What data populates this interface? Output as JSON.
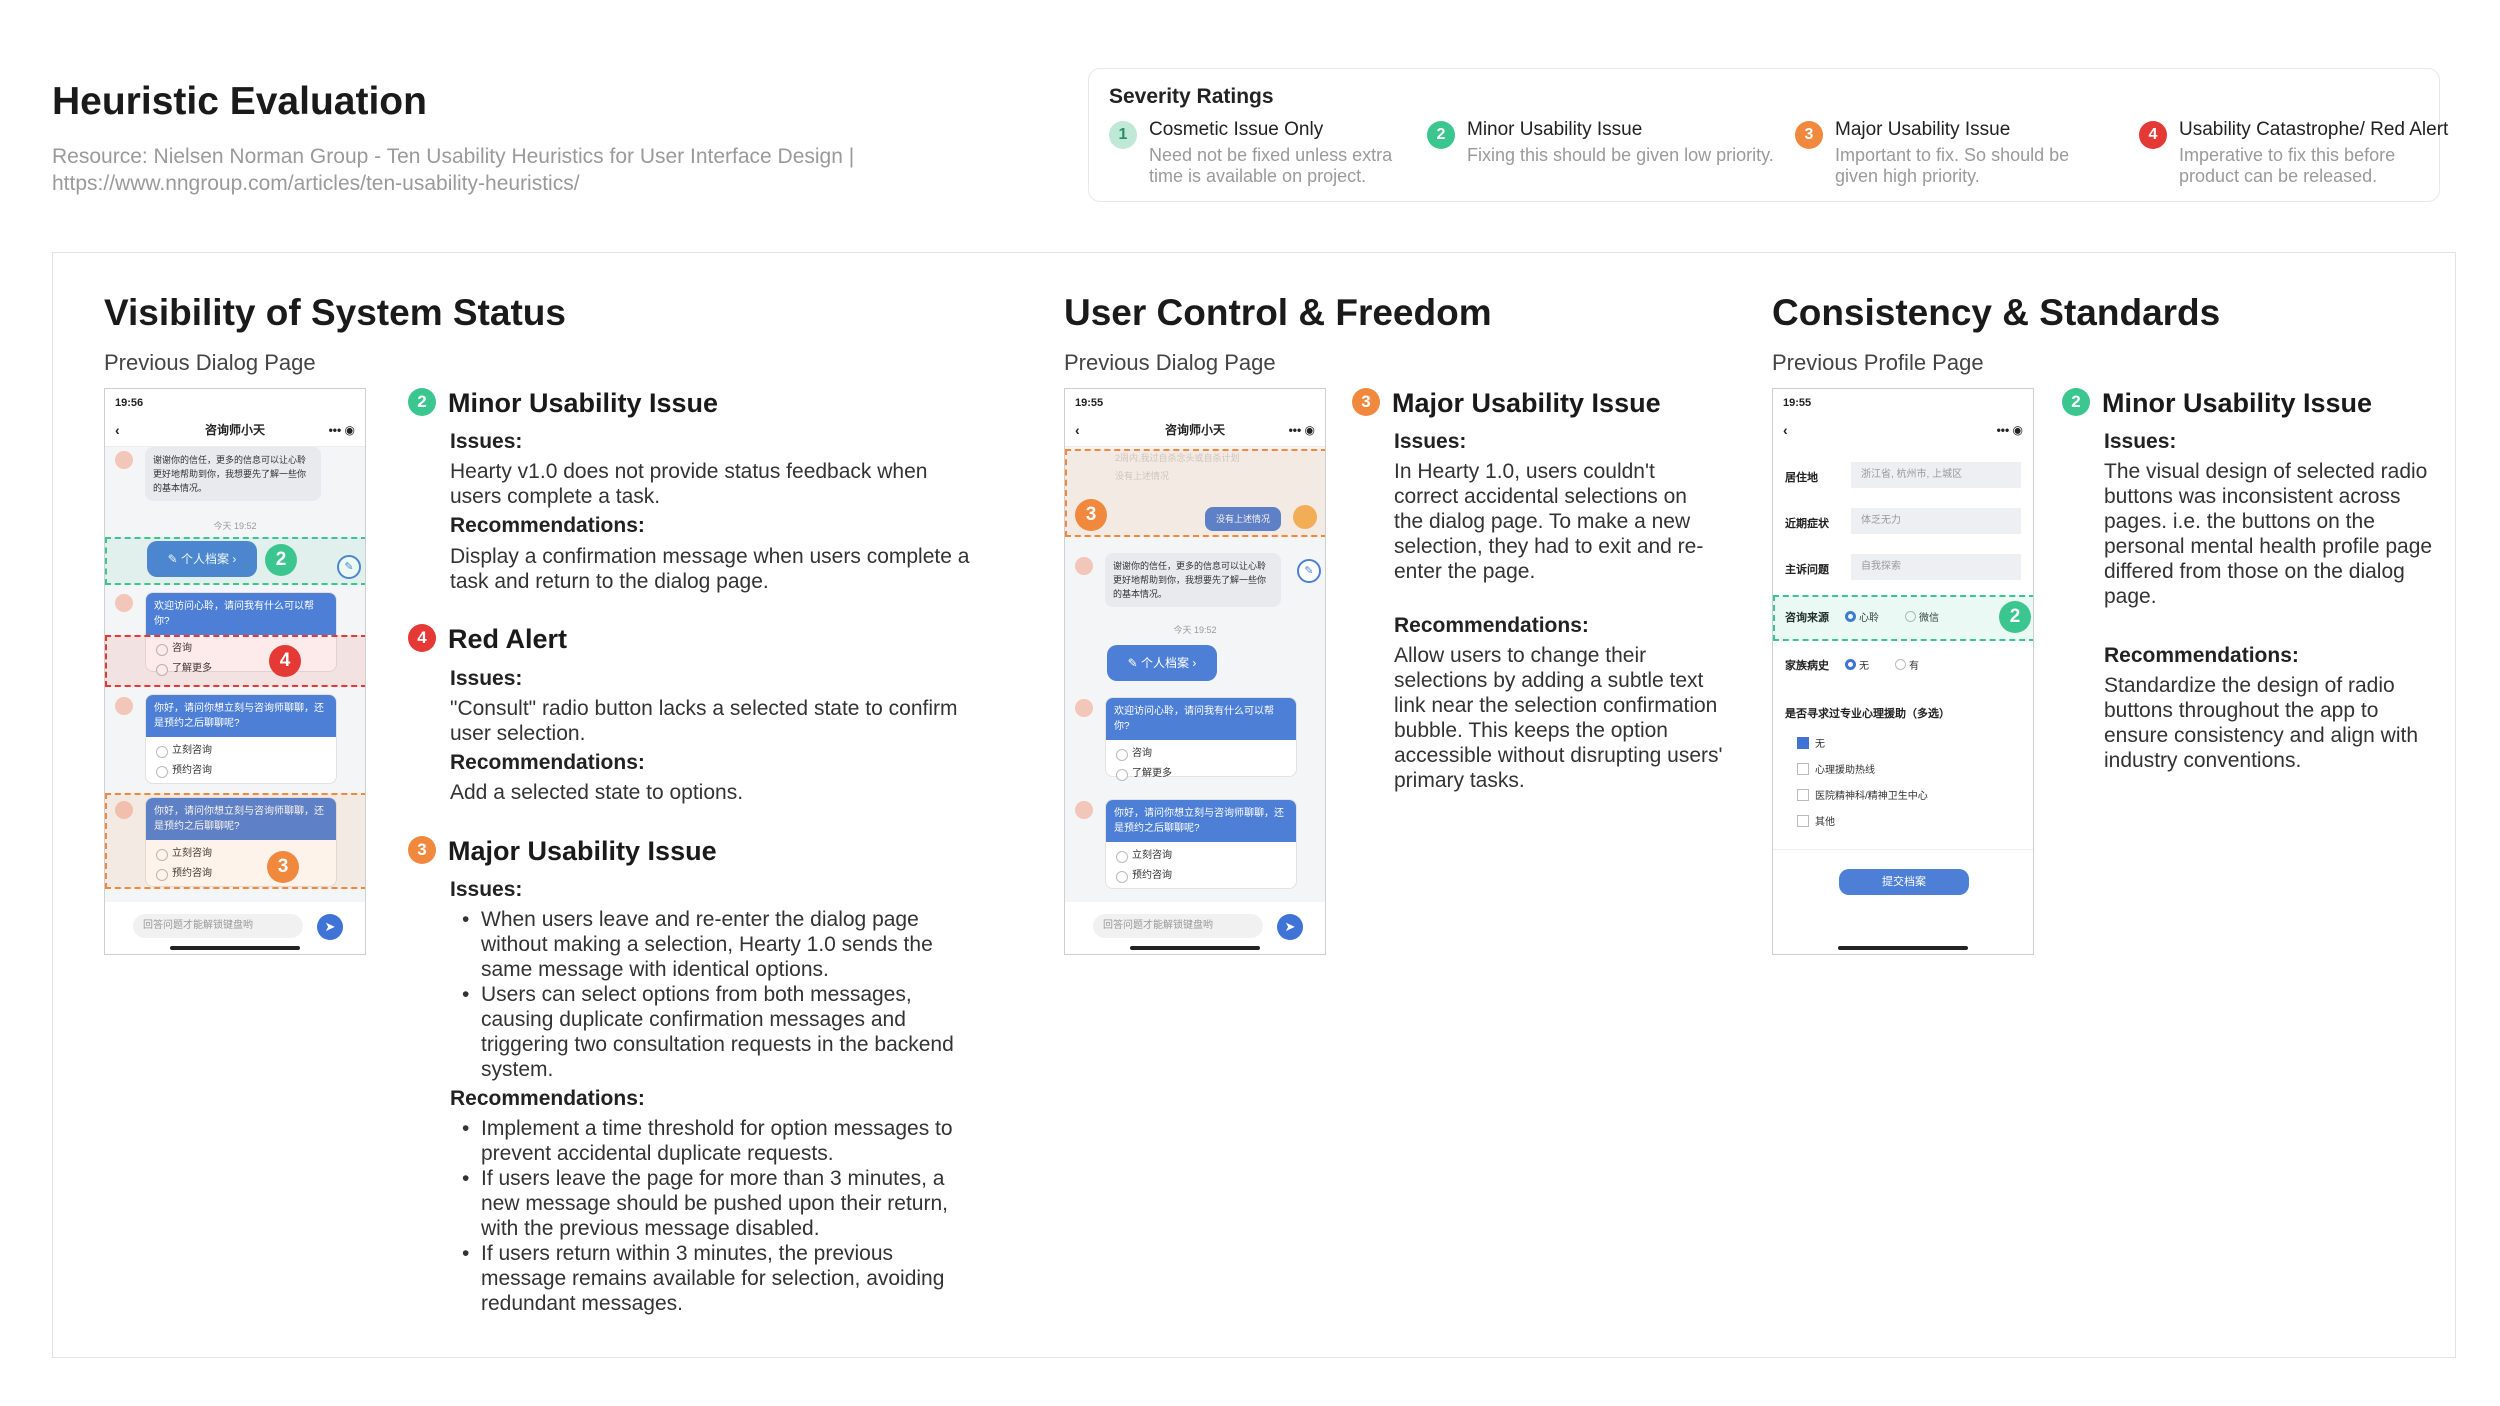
{
  "header": {
    "title": "Heuristic Evaluation",
    "resource": "Resource: Nielsen Norman Group - Ten Usability Heuristics for User Interface Design | https://www.nngroup.com/articles/ten-usability-heuristics/"
  },
  "severity": {
    "title": "Severity Ratings",
    "items": [
      {
        "num": "1",
        "name": "Cosmetic Issue Only",
        "desc": "Need not be fixed unless extra time is available on project.",
        "color": "#bfe8d6"
      },
      {
        "num": "2",
        "name": "Minor Usability Issue",
        "desc": "Fixing this should be given low priority.",
        "color": "#3cc68f"
      },
      {
        "num": "3",
        "name": "Major Usability Issue",
        "desc": "Important to fix. So should be given high priority.",
        "color": "#f0883e"
      },
      {
        "num": "4",
        "name": "Usability Catastrophe/ Red Alert",
        "desc": "Imperative to fix this before product can be released.",
        "color": "#e53935"
      }
    ]
  },
  "sections": [
    {
      "title": "Visibility of System Status",
      "subtitle": "Previous Dialog Page",
      "phone": {
        "time": "19:56",
        "nav_title": "咨询师小天",
        "msg1": "谢谢你的信任，更多的信息可以让心聆更好地帮助到你，我想要先了解一些你的基本情况。",
        "timestamp": "今天 19:52",
        "profile_pill": "个人档案",
        "msg2": "欢迎访问心聆，请问我有什么可以帮你?",
        "opt_consult": "咨询",
        "opt_learn": "了解更多",
        "msg3": "你好，请问你想立刻与咨询师聊聊，还是预约之后聊聊呢?",
        "opt_now": "立刻咨询",
        "opt_book": "预约咨询",
        "input_placeholder": "回答问题才能解锁键盘哟",
        "badge_green": "2",
        "badge_red": "4",
        "badge_orange": "3"
      },
      "issues": [
        {
          "num": "2",
          "heading": "Minor Usability Issue",
          "issues_label": "Issues:",
          "issue_text": "Hearty v1.0 does not provide status feedback when users complete a task.",
          "rec_label": "Recommendations:",
          "rec_text": "Display a confirmation message when users complete a task and return to the dialog page."
        },
        {
          "num": "4",
          "heading": "Red Alert",
          "issues_label": "Issues:",
          "issue_text": "\"Consult\" radio button lacks a selected state to confirm user selection.",
          "rec_label": "Recommendations:",
          "rec_text": "Add a selected state to options."
        },
        {
          "num": "3",
          "heading": "Major Usability Issue",
          "issues_label": "Issues:",
          "issue_bullets": [
            "When users leave and re-enter the dialog page without making a selection, Hearty 1.0 sends the same message with identical options.",
            "Users can select options from both messages, causing duplicate confirmation messages and triggering two consultation requests in the backend system."
          ],
          "rec_label": "Recommendations:",
          "rec_bullets": [
            "Implement a time threshold for option messages to prevent accidental duplicate requests.",
            "If users leave the page for more than 3 minutes, a new message should be pushed upon their return, with the previous message disabled.",
            "If users return within 3 minutes, the previous message remains available for selection, avoiding redundant messages."
          ]
        }
      ]
    },
    {
      "title": "User Control & Freedom",
      "subtitle": "Previous Dialog Page",
      "phone": {
        "time": "19:55",
        "nav_title": "咨询师小天",
        "faded1": "2周内,我过自杀念头或自杀计划",
        "faded2": "没有上述情况",
        "user_reply": "没有上述情况",
        "msg1": "谢谢你的信任，更多的信息可以让心聆更好地帮助到你，我想要先了解一些你的基本情况。",
        "timestamp": "今天 19:52",
        "profile_pill": "个人档案",
        "msg2": "欢迎访问心聆，请问我有什么可以帮你?",
        "opt_consult": "咨询",
        "opt_learn": "了解更多",
        "msg3": "你好，请问你想立刻与咨询师聊聊，还是预约之后聊聊呢?",
        "opt_now": "立刻咨询",
        "opt_book": "预约咨询",
        "input_placeholder": "回答问题才能解锁键盘哟",
        "badge_orange": "3"
      },
      "issues": [
        {
          "num": "3",
          "heading": "Major Usability Issue",
          "issues_label": "Issues:",
          "issue_text": "In Hearty 1.0, users couldn't correct accidental selections on the dialog page. To make a new selection, they had to exit and re-enter the page.",
          "rec_label": "Recommendations:",
          "rec_text": "Allow users to change their selections by adding a subtle text link near the selection confirmation bubble. This keeps the option accessible without disrupting users' primary tasks."
        }
      ]
    },
    {
      "title": "Consistency & Standards",
      "subtitle": "Previous Profile Page",
      "phone": {
        "time": "19:55",
        "rows": [
          {
            "label": "居住地",
            "value": "浙江省, 杭州市, 上城区"
          },
          {
            "label": "近期症状",
            "value": "体乏无力"
          },
          {
            "label": "主诉问题",
            "value": "自我探索"
          }
        ],
        "source_label": "咨询来源",
        "source_opt1": "心聆",
        "source_opt2": "微信",
        "family_label": "家族病史",
        "family_opt1": "无",
        "family_opt2": "有",
        "help_question": "是否寻求过专业心理援助（多选）",
        "help_opts": [
          "无",
          "心理援助热线",
          "医院精神科/精神卫生中心",
          "其他"
        ],
        "submit": "提交档案",
        "badge_green": "2"
      },
      "issues": [
        {
          "num": "2",
          "heading": "Minor Usability Issue",
          "issues_label": "Issues:",
          "issue_text": "The visual design of selected radio buttons was inconsistent across pages. i.e. the buttons on the personal mental health profile page differed from those on the dialog page.",
          "rec_label": "Recommendations:",
          "rec_text": "Standardize the design of radio buttons throughout the app to ensure consistency and align with industry conventions."
        }
      ]
    }
  ]
}
